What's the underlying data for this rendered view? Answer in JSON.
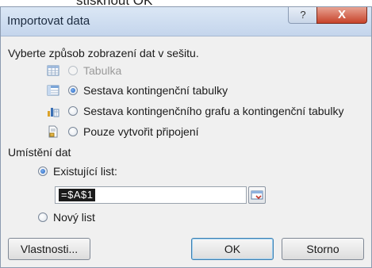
{
  "caption": "stisknout OK",
  "window": {
    "title": "Importovat data",
    "help_label": "?",
    "close_label": "X"
  },
  "display": {
    "prompt": "Vyberte způsob zobrazení dat v sešitu.",
    "options": [
      {
        "label": "Tabulka",
        "enabled": false,
        "selected": false,
        "icon": "table-icon"
      },
      {
        "label": "Sestava kontingenční tabulky",
        "enabled": true,
        "selected": true,
        "icon": "pivot-table-icon"
      },
      {
        "label": "Sestava kontingenčního grafu a kontingenční tabulky",
        "enabled": true,
        "selected": false,
        "icon": "pivot-chart-icon"
      },
      {
        "label": "Pouze vytvořit připojení",
        "enabled": true,
        "selected": false,
        "icon": "connection-icon"
      }
    ]
  },
  "location": {
    "heading": "Umístění dat",
    "existing_label": "Existující list:",
    "existing_value": "=$A$1",
    "new_label": "Nový list"
  },
  "buttons": {
    "properties": "Vlastnosti...",
    "ok": "OK",
    "cancel": "Storno"
  }
}
